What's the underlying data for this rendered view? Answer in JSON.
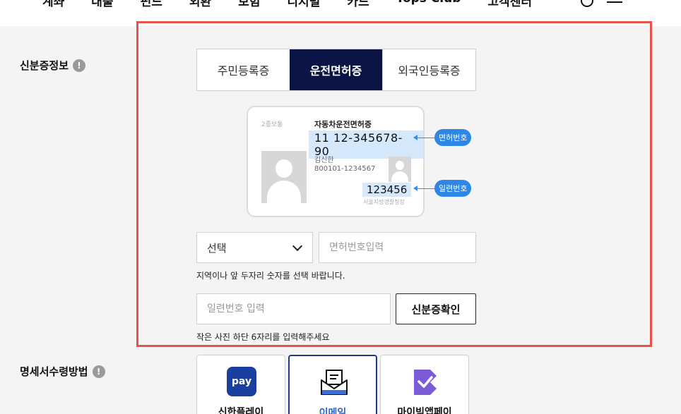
{
  "nav": {
    "items": [
      "계좌",
      "대출",
      "펀드",
      "외환",
      "보험",
      "디지털",
      "카드",
      "Tops Club",
      "고객센터"
    ]
  },
  "identity": {
    "label": "신분증정보",
    "info_icon": "!",
    "tabs": [
      {
        "label": "주민등록증",
        "active": false
      },
      {
        "label": "운전면허증",
        "active": true
      },
      {
        "label": "외국인등록증",
        "active": false
      }
    ],
    "card": {
      "type": "2종보통",
      "title": "자동차운전면허증",
      "license_number": "11 12-345678-90",
      "name": "김신한",
      "rrn": "800101-1234567",
      "serial": "123456",
      "issuer": "서울지방경찰청장",
      "callout_license": "면허번호",
      "callout_serial": "일련번호"
    },
    "region_select": {
      "value": "선택"
    },
    "license_input": {
      "placeholder": "면허번호입력"
    },
    "region_hint": "지역이나 앞 두자리 숫자를 선택 바랍니다.",
    "serial_input": {
      "placeholder": "일련번호 입력"
    },
    "confirm_button": "신분증확인",
    "serial_hint": "작은 사진 하단 6자리를 입력해주세요"
  },
  "receipt": {
    "label": "명세서수령방법",
    "info_icon": "!",
    "options": [
      {
        "label": "신한플레이",
        "icon": "shinhan-pay-icon",
        "icon_text": "pay",
        "active": false
      },
      {
        "label": "이메일",
        "icon": "email-icon",
        "active": true
      },
      {
        "label": "마이빅앱페이",
        "icon": "mybig-app-icon",
        "active": false
      }
    ]
  },
  "colors": {
    "active_tab": "#0b1445",
    "highlight_border": "#e8524a",
    "callout_blue": "#2e86e6",
    "active_option_text": "#2a64d6"
  }
}
